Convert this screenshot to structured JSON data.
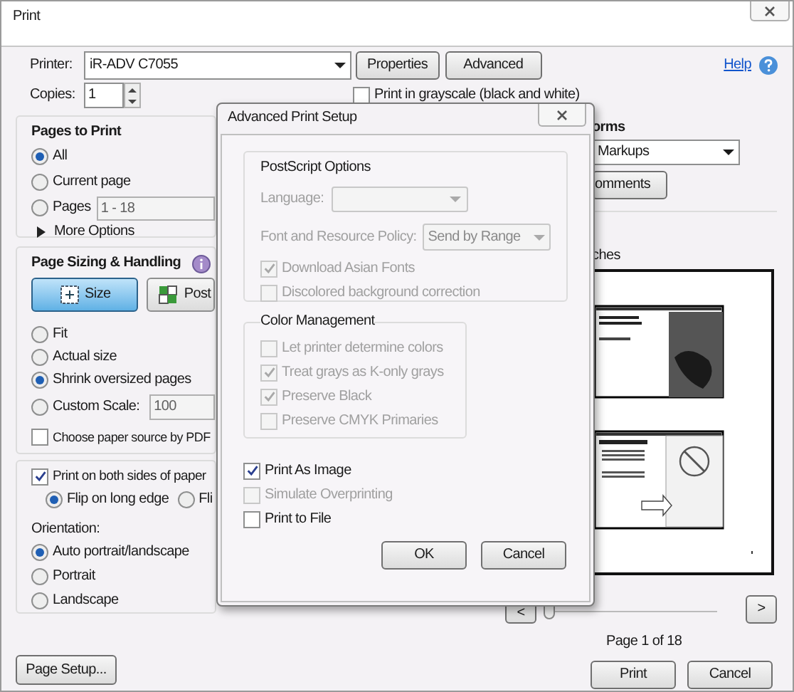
{
  "window": {
    "title": "Print"
  },
  "printer": {
    "label": "Printer:",
    "value": "iR-ADV C7055"
  },
  "top_buttons": [
    "Properties",
    "Advanced"
  ],
  "help": {
    "label": "Help"
  },
  "copies": {
    "label": "Copies:",
    "value": "1"
  },
  "grayscale": {
    "label": "Print in grayscale (black and white)",
    "checked": false
  },
  "pages_to_print": {
    "title": "Pages to Print",
    "options": [
      {
        "label": "All",
        "selected": true
      },
      {
        "label": "Current page",
        "selected": false
      },
      {
        "label": "Pages",
        "selected": false,
        "value": "1 - 18"
      }
    ],
    "more_options": "More Options"
  },
  "page_sizing": {
    "title": "Page Sizing & Handling",
    "modes": [
      {
        "label": "Size",
        "selected": true
      },
      {
        "label": "Post",
        "selected": false
      }
    ],
    "options": [
      {
        "label": "Fit",
        "selected": false
      },
      {
        "label": "Actual size",
        "selected": false
      },
      {
        "label": "Shrink oversized pages",
        "selected": true
      },
      {
        "label": "Custom Scale:",
        "selected": false,
        "value": "100"
      }
    ],
    "paper_source": {
      "label": "Choose paper source by PDF",
      "checked": false
    }
  },
  "duplex": {
    "label": "Print on both sides of paper",
    "checked": true,
    "flip": [
      {
        "label": "Flip on long edge",
        "selected": true
      },
      {
        "label": "Fli",
        "selected": false
      }
    ]
  },
  "orientation": {
    "label": "Orientation:",
    "options": [
      {
        "label": "Auto portrait/landscape",
        "selected": true
      },
      {
        "label": "Portrait",
        "selected": false
      },
      {
        "label": "Landscape",
        "selected": false
      }
    ]
  },
  "page_setup": "Page Setup...",
  "comments_forms": {
    "title": "orms",
    "value": "Markups",
    "button": "omments"
  },
  "preview": {
    "units": "ches",
    "page_label": "Page 1 of 18",
    "prev": "<",
    "next": ">",
    "slider": {
      "level": 0
    }
  },
  "actions": [
    "Print",
    "Cancel"
  ],
  "advanced": {
    "title": "Advanced Print Setup",
    "postscript": {
      "title": "PostScript Options",
      "language": {
        "label": "Language:",
        "disabled": true
      },
      "policy": {
        "label": "Font and Resource Policy:",
        "value": "Send by Range",
        "disabled": true
      },
      "options": [
        {
          "label": "Download Asian Fonts",
          "checked": true,
          "disabled": true
        },
        {
          "label": "Discolored background correction",
          "checked": false,
          "disabled": true
        }
      ]
    },
    "color_management": {
      "title": "Color Management",
      "options": [
        {
          "label": "Let printer determine colors",
          "checked": false,
          "disabled": true
        },
        {
          "label": "Treat grays as K-only grays",
          "checked": true,
          "disabled": true
        },
        {
          "label": "Preserve Black",
          "checked": true,
          "disabled": true
        },
        {
          "label": "Preserve CMYK Primaries",
          "checked": false,
          "disabled": true
        }
      ]
    },
    "options": [
      {
        "label": "Print As Image",
        "checked": true,
        "disabled": false
      },
      {
        "label": "Simulate Overprinting",
        "checked": false,
        "disabled": true
      },
      {
        "label": "Print to File",
        "checked": false,
        "disabled": false
      }
    ],
    "buttons": [
      "OK",
      "Cancel"
    ]
  }
}
